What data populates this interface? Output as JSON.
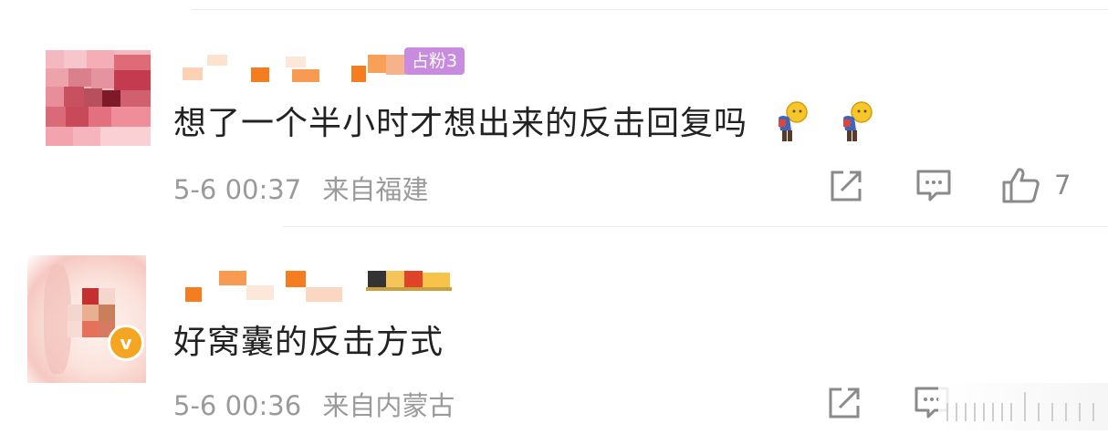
{
  "comments": [
    {
      "text": "想了一个半小时才想出来的反击回复吗",
      "fan_badge": "占粉3",
      "date": "5-6 00:37",
      "location": "来自福建",
      "likes": "7",
      "emoji_count": 2
    },
    {
      "text": "好窝囊的反击方式",
      "date": "5-6 00:36",
      "location": "来自内蒙古",
      "verified_badge": "v"
    }
  ],
  "colors": {
    "text": "#222222",
    "meta": "#9a9a9a",
    "fan_badge": "#c98be0",
    "verified": "#f4a623",
    "icon": "#8a8a8a"
  },
  "icons": [
    "repost-icon",
    "comment-icon",
    "like-icon",
    "emoji-bowing-man"
  ]
}
